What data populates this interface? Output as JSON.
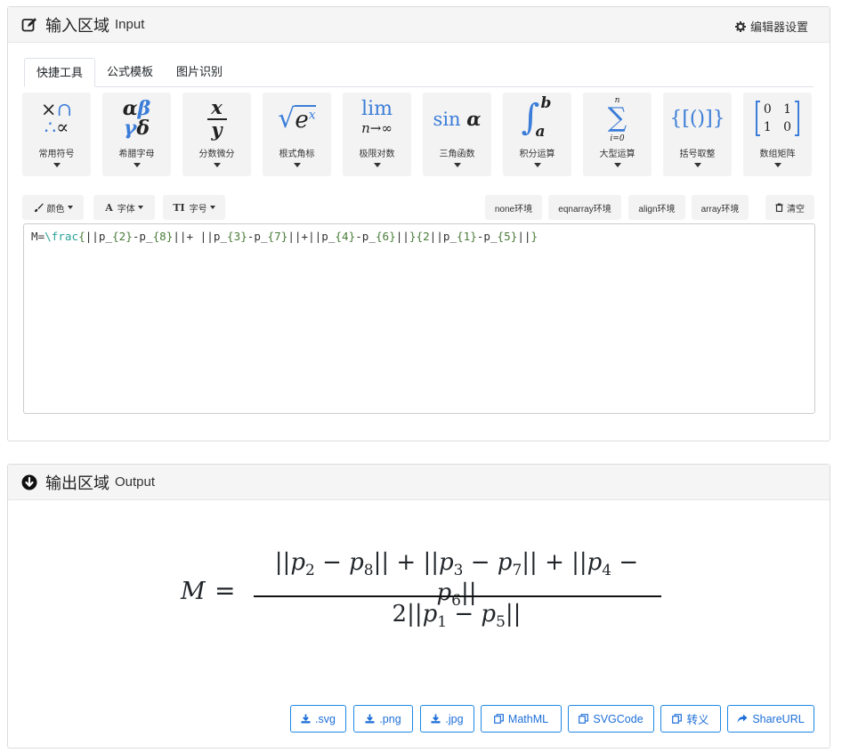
{
  "input_panel": {
    "title": "输入区域",
    "subtitle": "Input",
    "settings_label": "编辑器设置",
    "tabs": [
      "快捷工具",
      "公式模板",
      "图片识别"
    ],
    "tools": [
      {
        "label": "常用符号"
      },
      {
        "label": "希腊字母"
      },
      {
        "label": "分数微分"
      },
      {
        "label": "根式角标"
      },
      {
        "label": "极限对数"
      },
      {
        "label": "三角函数"
      },
      {
        "label": "积分运算"
      },
      {
        "label": "大型运算"
      },
      {
        "label": "括号取整"
      },
      {
        "label": "数组矩阵"
      }
    ],
    "format_buttons": {
      "color": "颜色",
      "font": "字体",
      "size": "字号",
      "none_env": "none环境",
      "eqnarray_env": "eqnarray环境",
      "align_env": "align环境",
      "array_env": "array环境",
      "clear": "清空"
    },
    "editor_value": "M=\\frac{||p_{2}-p_{8}||+ ||p_{3}-p_{7}||+||p_{4}-p_{6}||}{2||p_{1}-p_{5}||}"
  },
  "output_panel": {
    "title": "输出区域",
    "subtitle": "Output",
    "formula": {
      "lhs": "M",
      "numerator": "||p2 − p8|| + ||p3 − p7|| + ||p4 − p6||",
      "denominator": "2||p1 − p5||"
    },
    "export_buttons": [
      ".svg",
      ".png",
      ".jpg",
      "MathML",
      "SVGCode",
      "转义",
      "ShareURL"
    ]
  },
  "colors": {
    "accent": "#1e88e5",
    "latex_command": "#2aa198",
    "latex_brace": "#4a7c3a",
    "symbol_blue": "#3b7dd8"
  }
}
